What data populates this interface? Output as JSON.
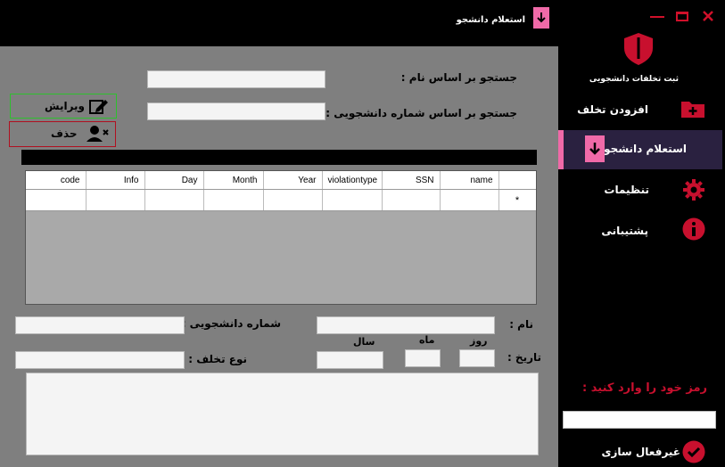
{
  "window": {
    "title": "استعلام دانشجو",
    "controls": [
      "minimize-icon",
      "maximize-icon",
      "close-icon"
    ]
  },
  "sidebar": {
    "header": "ثبت تخلفات دانشجویی",
    "items": [
      {
        "label": "افزودن تخلف",
        "icon": "folder-plus-icon",
        "active": false
      },
      {
        "label": "استعلام دانشجو",
        "icon": "file-download-icon",
        "active": true
      },
      {
        "label": "تنظیمات",
        "icon": "gear-icon",
        "active": false
      },
      {
        "label": "پشتیبانی",
        "icon": "info-icon",
        "active": false
      }
    ],
    "password_prompt": "رمز خود را وارد کنید :",
    "password_value": "",
    "deactivate_label": "غیرفعال سازی"
  },
  "search": {
    "by_name_label": "جستجو بر اساس نام :",
    "by_name_value": "",
    "by_id_label": "جستجو بر اساس شماره دانشجویی :",
    "by_id_value": ""
  },
  "actions": {
    "edit_label": "ویرایش",
    "delete_label": "حذف"
  },
  "grid": {
    "columns": [
      "code",
      "Info",
      "Day",
      "Month",
      "Year",
      "violationtype",
      "SSN",
      "name"
    ],
    "new_row_marker": "*"
  },
  "form": {
    "name_label": "نام :",
    "name_value": "",
    "student_id_label": "شماره دانشجویی :",
    "student_id_value": "",
    "date_label": "تاریخ :",
    "day_label": "روز",
    "month_label": "ماه",
    "year_label": "سال",
    "day_value": "",
    "month_value": "",
    "year_value": "",
    "violation_type_label": "نوع تخلف :",
    "violation_type_value": "",
    "info_value": ""
  },
  "colors": {
    "accent_pink": "#f06aa8",
    "shield_red": "#c8102e",
    "active_item_bg": "#2a2140",
    "main_bg": "#7f7f7f",
    "prompt_red": "#c8102e"
  }
}
